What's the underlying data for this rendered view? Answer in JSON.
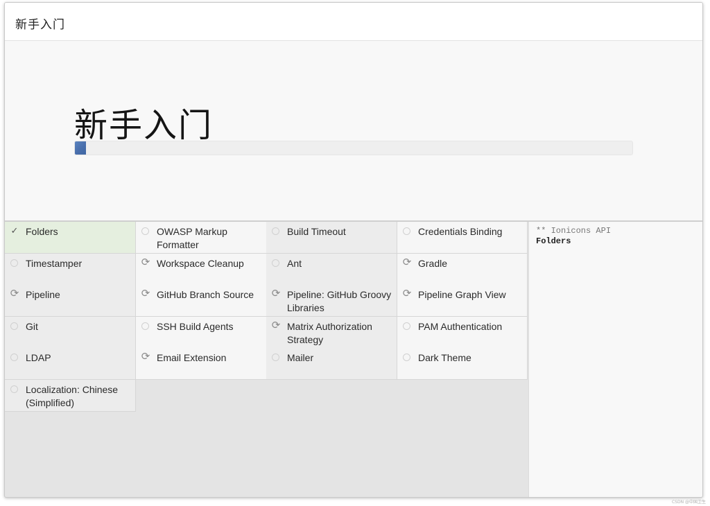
{
  "window": {
    "title": "新手入门"
  },
  "hero": {
    "heading": "新手入门",
    "progress_fraction": 0.02
  },
  "plugins": [
    {
      "name": "Folders",
      "status": "done"
    },
    {
      "name": "OWASP Markup Formatter",
      "status": "pending"
    },
    {
      "name": "Build Timeout",
      "status": "pending"
    },
    {
      "name": "Credentials Binding",
      "status": "pending"
    },
    {
      "name": "Timestamper",
      "status": "pending"
    },
    {
      "name": "Workspace Cleanup",
      "status": "installing"
    },
    {
      "name": "Ant",
      "status": "pending"
    },
    {
      "name": "Gradle",
      "status": "installing"
    },
    {
      "name": "Pipeline",
      "status": "installing"
    },
    {
      "name": "GitHub Branch Source",
      "status": "installing"
    },
    {
      "name": "Pipeline: GitHub Groovy Libraries",
      "status": "installing"
    },
    {
      "name": "Pipeline Graph View",
      "status": "installing"
    },
    {
      "name": "Git",
      "status": "pending"
    },
    {
      "name": "SSH Build Agents",
      "status": "pending"
    },
    {
      "name": "Matrix Authorization Strategy",
      "status": "installing"
    },
    {
      "name": "PAM Authentication",
      "status": "pending"
    },
    {
      "name": "LDAP",
      "status": "pending"
    },
    {
      "name": "Email Extension",
      "status": "installing"
    },
    {
      "name": "Mailer",
      "status": "pending"
    },
    {
      "name": "Dark Theme",
      "status": "pending"
    },
    {
      "name": "Localization: Chinese (Simplified)",
      "status": "pending"
    }
  ],
  "log": {
    "line1": "** Ionicons API",
    "line2": "Folders"
  },
  "watermark": "CSDN @中国卫生"
}
